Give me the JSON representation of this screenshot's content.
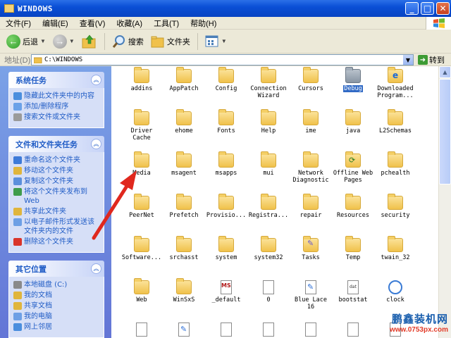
{
  "window": {
    "title": "WINDOWS",
    "min_label": "_",
    "max_label": "□",
    "close_label": "✕"
  },
  "menu": [
    {
      "label": "文件(F)"
    },
    {
      "label": "编辑(E)"
    },
    {
      "label": "查看(V)"
    },
    {
      "label": "收藏(A)"
    },
    {
      "label": "工具(T)"
    },
    {
      "label": "帮助(H)"
    }
  ],
  "toolbar": {
    "back_label": "后退",
    "search_label": "搜索",
    "folders_label": "文件夹"
  },
  "address": {
    "label": "地址(D)",
    "value": "C:\\WINDOWS",
    "go_label": "转到"
  },
  "sidebar": {
    "system_tasks": {
      "title": "系统任务",
      "items": [
        {
          "label": "隐藏此文件夹中的内容",
          "color": "#4a8ede"
        },
        {
          "label": "添加/删除程序",
          "color": "#6aa1e8"
        },
        {
          "label": "搜索文件或文件夹",
          "color": "#9a9a9a"
        }
      ]
    },
    "file_tasks": {
      "title": "文件和文件夹任务",
      "items": [
        {
          "label": "重命名这个文件夹",
          "color": "#3d7ad8"
        },
        {
          "label": "移动这个文件夹",
          "color": "#e0b53c"
        },
        {
          "label": "复制这个文件夹",
          "color": "#5b8fdc"
        },
        {
          "label": "将这个文件夹发布到 Web",
          "color": "#3f9c4c"
        },
        {
          "label": "共享此文件夹",
          "color": "#e0b53c"
        },
        {
          "label": "以电子邮件形式发送该文件夹内的文件",
          "color": "#6d9fe5"
        },
        {
          "label": "删除这个文件夹",
          "color": "#d9342b"
        }
      ]
    },
    "other_places": {
      "title": "其它位置",
      "items": [
        {
          "label": "本地磁盘 (C:)",
          "color": "#8a8a8a"
        },
        {
          "label": "我的文档",
          "color": "#e0b53c"
        },
        {
          "label": "共享文档",
          "color": "#e0b53c"
        },
        {
          "label": "我的电脑",
          "color": "#6d9fe5"
        },
        {
          "label": "网上邻居",
          "color": "#4a8ede"
        }
      ]
    }
  },
  "files": [
    {
      "name": "addins",
      "type": "folder"
    },
    {
      "name": "AppPatch",
      "type": "folder"
    },
    {
      "name": "Config",
      "type": "folder"
    },
    {
      "name": "Connection\nWizard",
      "type": "folder"
    },
    {
      "name": "Cursors",
      "type": "folder"
    },
    {
      "name": "Debug",
      "type": "folder-grey",
      "selected": true
    },
    {
      "name": "Downloaded\nProgram...",
      "type": "folder-ie"
    },
    {
      "name": "Driver\nCache",
      "type": "folder"
    },
    {
      "name": "ehome",
      "type": "folder"
    },
    {
      "name": "Fonts",
      "type": "folder"
    },
    {
      "name": "Help",
      "type": "folder"
    },
    {
      "name": "ime",
      "type": "folder"
    },
    {
      "name": "java",
      "type": "folder"
    },
    {
      "name": "L2Schemas",
      "type": "folder"
    },
    {
      "name": "Media",
      "type": "folder"
    },
    {
      "name": "msagent",
      "type": "folder"
    },
    {
      "name": "msapps",
      "type": "folder"
    },
    {
      "name": "mui",
      "type": "folder"
    },
    {
      "name": "Network\nDiagnostic",
      "type": "folder"
    },
    {
      "name": "Offline Web\nPages",
      "type": "folder-web"
    },
    {
      "name": "pchealth",
      "type": "folder"
    },
    {
      "name": "PeerNet",
      "type": "folder"
    },
    {
      "name": "Prefetch",
      "type": "folder"
    },
    {
      "name": "Provisio...",
      "type": "folder"
    },
    {
      "name": "Registra...",
      "type": "folder"
    },
    {
      "name": "repair",
      "type": "folder"
    },
    {
      "name": "Resources",
      "type": "folder"
    },
    {
      "name": "security",
      "type": "folder"
    },
    {
      "name": "Software...",
      "type": "folder"
    },
    {
      "name": "srchasst",
      "type": "folder"
    },
    {
      "name": "system",
      "type": "folder"
    },
    {
      "name": "system32",
      "type": "folder"
    },
    {
      "name": "Tasks",
      "type": "folder-tasks"
    },
    {
      "name": "Temp",
      "type": "folder"
    },
    {
      "name": "twain_32",
      "type": "folder"
    },
    {
      "name": "Web",
      "type": "folder"
    },
    {
      "name": "WinSxS",
      "type": "folder"
    },
    {
      "name": "_default",
      "type": "file-ms"
    },
    {
      "name": "0",
      "type": "file"
    },
    {
      "name": "Blue Lace\n16",
      "type": "file-paint"
    },
    {
      "name": "bootstat",
      "type": "file-dat"
    },
    {
      "name": "clock",
      "type": "file-clock"
    },
    {
      "name": "",
      "type": "file"
    },
    {
      "name": "",
      "type": "file-paint"
    },
    {
      "name": "",
      "type": "file"
    },
    {
      "name": "",
      "type": "file"
    },
    {
      "name": "",
      "type": "file"
    },
    {
      "name": "",
      "type": "file"
    },
    {
      "name": "",
      "type": "file"
    }
  ],
  "watermark": {
    "line1": "鹏鑫装机网",
    "line2": "www.0753px.com"
  },
  "colors": {
    "title_blue": "#0a4fd6",
    "sidebar_blue": "#6375d6",
    "arrow_red": "#e0281e",
    "selection": "#316ac5"
  }
}
